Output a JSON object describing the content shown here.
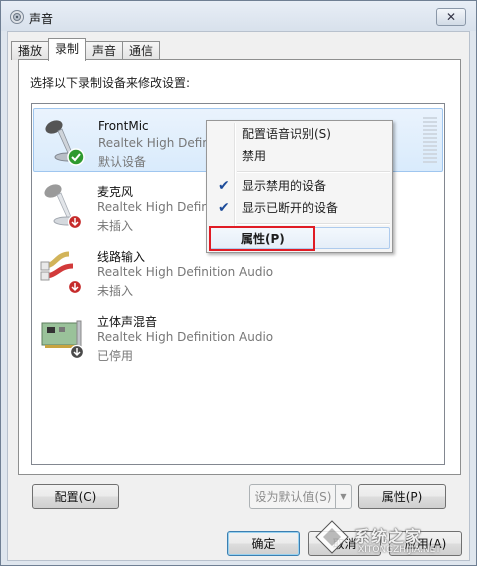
{
  "window": {
    "title": "声音"
  },
  "tabs": [
    {
      "label": "播放"
    },
    {
      "label": "录制"
    },
    {
      "label": "声音"
    },
    {
      "label": "通信"
    }
  ],
  "instruction": "选择以下录制设备来修改设置:",
  "devices": [
    {
      "name": "FrontMic",
      "driver": "Realtek High Definition Audio",
      "status": "默认设备",
      "icon": "microphone-icon",
      "badge": "default-check-icon",
      "selected": true
    },
    {
      "name": "麦克风",
      "driver": "Realtek High Definition Audio",
      "status": "未插入",
      "icon": "microphone-icon",
      "badge": "unplugged-arrow-icon",
      "selected": false
    },
    {
      "name": "线路输入",
      "driver": "Realtek High Definition Audio",
      "status": "未插入",
      "icon": "rca-cable-icon",
      "badge": "unplugged-arrow-icon",
      "selected": false
    },
    {
      "name": "立体声混音",
      "driver": "Realtek High Definition Audio",
      "status": "已停用",
      "icon": "sound-card-icon",
      "badge": "disabled-arrow-icon",
      "selected": false
    }
  ],
  "context_menu": {
    "items": [
      {
        "label": "配置语音识别(S)",
        "checked": false
      },
      {
        "label": "禁用",
        "checked": false
      },
      {
        "label": "显示禁用的设备",
        "checked": true
      },
      {
        "label": "显示已断开的设备",
        "checked": true
      },
      {
        "label": "属性(P)",
        "checked": false,
        "highlighted": true
      }
    ]
  },
  "buttons": {
    "configure": "配置(C)",
    "set_default": "设为默认值(S)",
    "properties": "属性(P)",
    "ok": "确定",
    "cancel": "取消",
    "apply": "应用(A)"
  },
  "watermark": {
    "text": "系统之家",
    "url": "XITONGZHIJIA.NET"
  },
  "colors": {
    "accent_highlight": "#e01b24",
    "selection": "#d9ebfc"
  }
}
